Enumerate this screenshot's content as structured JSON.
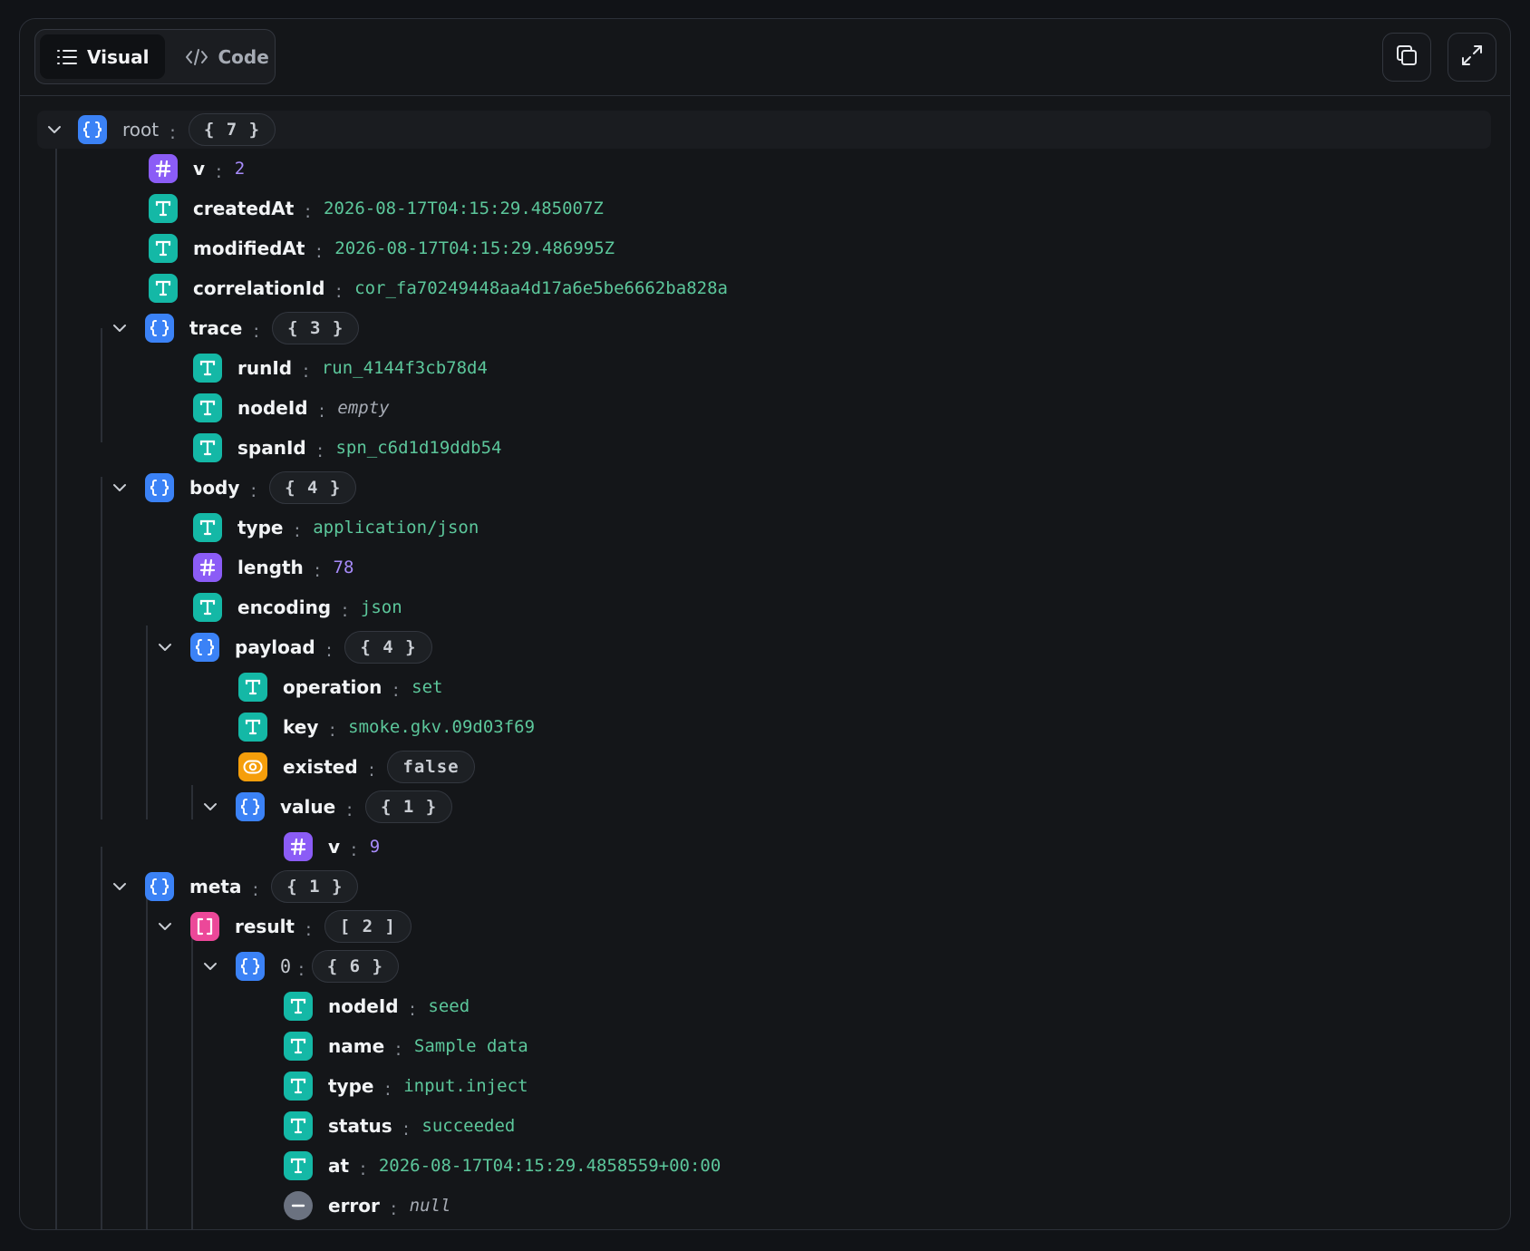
{
  "toolbar": {
    "visual_label": "Visual",
    "code_label": "Code"
  },
  "tree": {
    "root": {
      "key": "root",
      "count": "{ 7 }"
    },
    "v": {
      "key": "v",
      "value": "2"
    },
    "createdAt": {
      "key": "createdAt",
      "value": "2026-08-17T04:15:29.485007Z"
    },
    "modifiedAt": {
      "key": "modifiedAt",
      "value": "2026-08-17T04:15:29.486995Z"
    },
    "correlationId": {
      "key": "correlationId",
      "value": "cor_fa70249448aa4d17a6e5be6662ba828a"
    },
    "trace": {
      "key": "trace",
      "count": "{ 3 }"
    },
    "trace_runId": {
      "key": "runId",
      "value": "run_4144f3cb78d4"
    },
    "trace_nodeId": {
      "key": "nodeId",
      "value": "empty"
    },
    "trace_spanId": {
      "key": "spanId",
      "value": "spn_c6d1d19ddb54"
    },
    "body": {
      "key": "body",
      "count": "{ 4 }"
    },
    "body_type": {
      "key": "type",
      "value": "application/json"
    },
    "body_length": {
      "key": "length",
      "value": "78"
    },
    "body_encoding": {
      "key": "encoding",
      "value": "json"
    },
    "payload": {
      "key": "payload",
      "count": "{ 4 }"
    },
    "payload_operation": {
      "key": "operation",
      "value": "set"
    },
    "payload_key": {
      "key": "key",
      "value": "smoke.gkv.09d03f69"
    },
    "payload_existed": {
      "key": "existed",
      "value": "false"
    },
    "payload_value": {
      "key": "value",
      "count": "{ 1 }"
    },
    "payload_value_v": {
      "key": "v",
      "value": "9"
    },
    "meta": {
      "key": "meta",
      "count": "{ 1 }"
    },
    "result": {
      "key": "result",
      "count": "[ 2 ]"
    },
    "result_0": {
      "key": "0",
      "count": "{ 6 }"
    },
    "r0_nodeId": {
      "key": "nodeId",
      "value": "seed"
    },
    "r0_name": {
      "key": "name",
      "value": "Sample data"
    },
    "r0_type": {
      "key": "type",
      "value": "input.inject"
    },
    "r0_status": {
      "key": "status",
      "value": "succeeded"
    },
    "r0_at": {
      "key": "at",
      "value": "2026-08-17T04:15:29.4858559+00:00"
    },
    "r0_error": {
      "key": "error",
      "value": "null"
    }
  },
  "colon": ":",
  "icons": {
    "object": "braces-icon",
    "string": "text-t-icon",
    "number": "hash-icon",
    "boolean": "toggle-icon",
    "array": "brackets-icon",
    "null": "minus-icon"
  },
  "colors": {
    "object": "#3b82f6",
    "string": "#14b8a6",
    "number": "#8b5cf6",
    "boolean": "#f59e0b",
    "array": "#ec4899",
    "null": "#6b7280",
    "string_value": "#5cc79b",
    "number_value": "#a78bfa"
  }
}
